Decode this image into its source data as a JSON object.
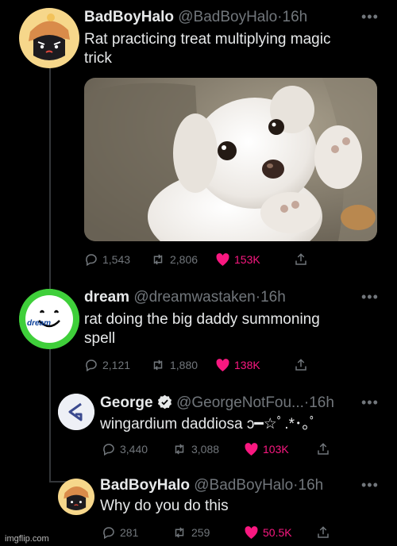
{
  "tweets": [
    {
      "name": "BadBoyHalo",
      "handle": "@BadBoyHalo",
      "dot": "·",
      "time": "16h",
      "text": "Rat practicing treat multiplying magic\ntrick",
      "replies": "1,543",
      "retweets": "2,806",
      "likes": "153K"
    },
    {
      "name": "dream",
      "handle": "@dreamwastaken",
      "dot": "·",
      "time": "16h",
      "avatar_label": "dream",
      "text": "rat doing the big daddy summoning\nspell",
      "replies": "2,121",
      "retweets": "1,880",
      "likes": "138K"
    },
    {
      "name": "George",
      "handle": "@GeorgeNotFou...",
      "dot": "·",
      "time": "16h",
      "text": "wingardium daddiosa ɔ━☆ﾟ.*･｡ﾟ",
      "replies": "3,440",
      "retweets": "3,088",
      "likes": "103K"
    },
    {
      "name": "BadBoyHalo",
      "handle": "@BadBoyHalo",
      "dot": "·",
      "time": "16h",
      "text": "Why do you do this",
      "replies": "281",
      "retweets": "259",
      "likes": "50.5K"
    }
  ],
  "more_label": "•••",
  "watermark": "imgflip.com",
  "colors": {
    "background": "#000000",
    "text": "#e7e9ea",
    "muted": "#71767b",
    "like": "#f91880",
    "verified": "#e7e9ea",
    "dream_green": "#3fcf3a"
  },
  "icons": [
    "reply-icon",
    "retweet-icon",
    "heart-icon",
    "share-icon",
    "verified-icon",
    "more-icon"
  ]
}
